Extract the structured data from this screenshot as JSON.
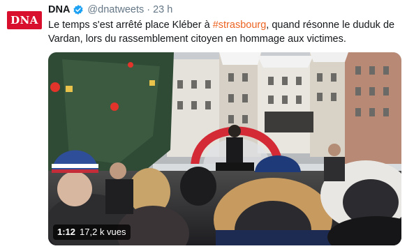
{
  "author": {
    "avatar_text": "DNA",
    "display_name": "DNA",
    "handle": "@dnatweets",
    "separator": "·",
    "time": "23 h"
  },
  "tweet": {
    "text_before": "Le temps s'est arrêté place Kléber à ",
    "hashtag": "#strasbourg",
    "text_after": ", quand résonne le duduk de Vardan, lors du rassemblement citoyen en hommage aux victimes."
  },
  "media": {
    "duration": "1:12",
    "views": "17,2 k vues"
  },
  "colors": {
    "brand_red": "#d9102d",
    "hashtag": "#ec6322",
    "verified": "#1da1f2",
    "secondary_text": "#657786"
  }
}
